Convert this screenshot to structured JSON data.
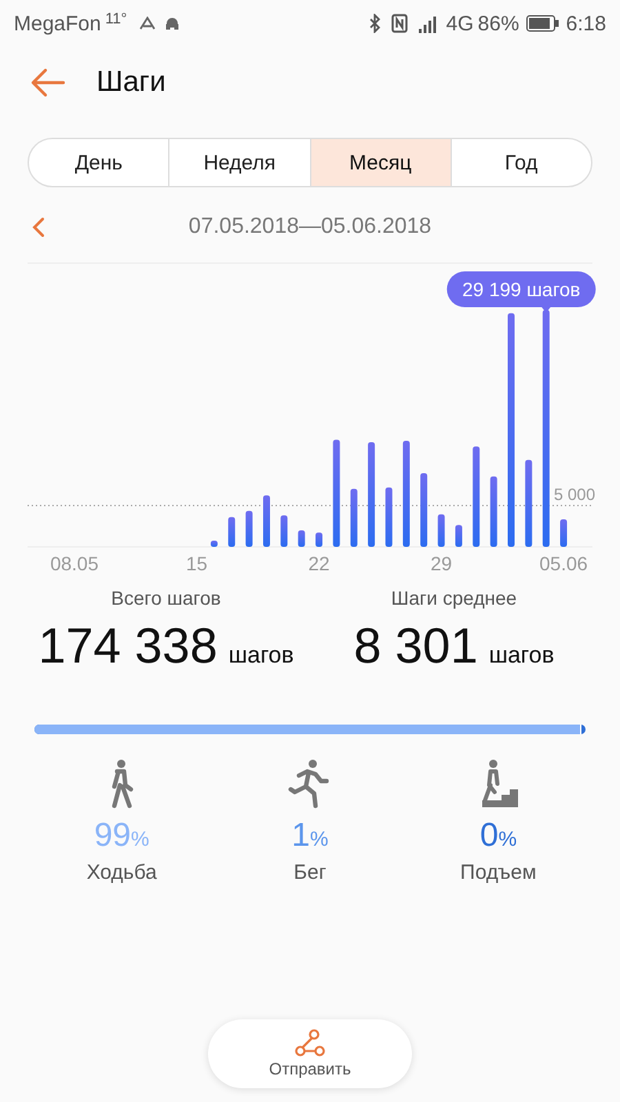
{
  "status_bar": {
    "carrier": "MegaFon",
    "notification": "11°",
    "network": "4G",
    "battery": "86%",
    "time": "6:18"
  },
  "header": {
    "title": "Шаги"
  },
  "tabs": [
    {
      "label": "День",
      "selected": false
    },
    {
      "label": "Неделя",
      "selected": false
    },
    {
      "label": "Месяц",
      "selected": true
    },
    {
      "label": "Год",
      "selected": false
    }
  ],
  "period": {
    "range": "07.05.2018—05.06.2018"
  },
  "chart": {
    "tooltip": "29 199 шагов",
    "ref_label": "5 000",
    "date_labels": [
      "08.05",
      "15",
      "22",
      "29",
      "05.06"
    ]
  },
  "totals": [
    {
      "label": "Всего шагов",
      "value": "174 338",
      "unit": "шагов"
    },
    {
      "label": "Шаги среднее",
      "value": "8 301",
      "unit": "шагов"
    }
  ],
  "activity_bar": {
    "level": 0.99
  },
  "activities": [
    {
      "kind": "walk",
      "percent": "99",
      "sign": "%",
      "label": "Ходьба",
      "color": "#8ab4f8"
    },
    {
      "kind": "run",
      "percent": "1",
      "sign": "%",
      "label": "Бег",
      "color": "#5b95ec"
    },
    {
      "kind": "climb",
      "percent": "0",
      "sign": "%",
      "label": "Подъем",
      "color": "#2f6fd6"
    }
  ],
  "share_button": {
    "label": "Отправить"
  }
}
